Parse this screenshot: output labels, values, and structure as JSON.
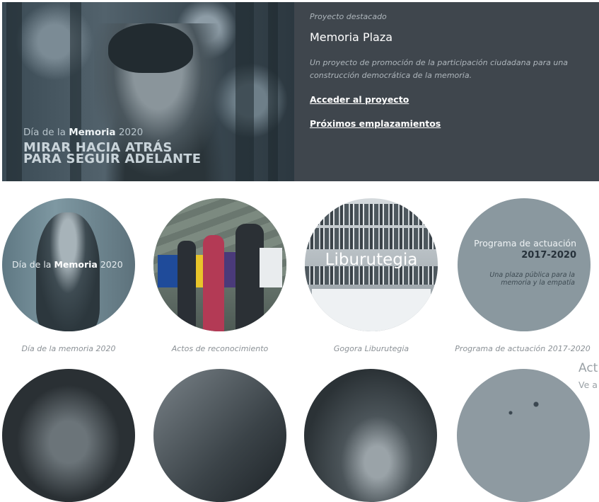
{
  "hero": {
    "overlay_day_prefix": "Día de la ",
    "overlay_day_bold": "Memoria",
    "overlay_year": " 2020",
    "overlay_line1": "MIRAR HACIA ATRÁS",
    "overlay_line2": "PARA SEGUIR ADELANTE",
    "kicker": "Proyecto destacado",
    "title": "Memoria Plaza",
    "description": "Un proyecto de promoción de la participación ciudadana para una construcción democrática de la memoria.",
    "link_access": "Acceder al proyecto",
    "link_locations": "Próximos emplazamientos"
  },
  "cards": [
    {
      "label_prefix": "Día de la ",
      "label_bold": "Memoria",
      "label_suffix": " 2020",
      "caption": "Día de la memoria 2020"
    },
    {
      "caption": "Actos de reconocimiento"
    },
    {
      "label": "Liburutegia",
      "caption": "Gogora Liburutegia"
    },
    {
      "line1": "Programa de actuación",
      "line2": "2017-2020",
      "line3": "Una plaza pública para la memoria y la empatía",
      "caption": "Programa de actuación 2017-2020"
    }
  ],
  "edge": {
    "title": "Act",
    "subtitle": "Ve a"
  },
  "colors": {
    "panel_bg": "#3f464d",
    "circle_gray": "#8a989f",
    "caption_text": "#8b9196"
  }
}
